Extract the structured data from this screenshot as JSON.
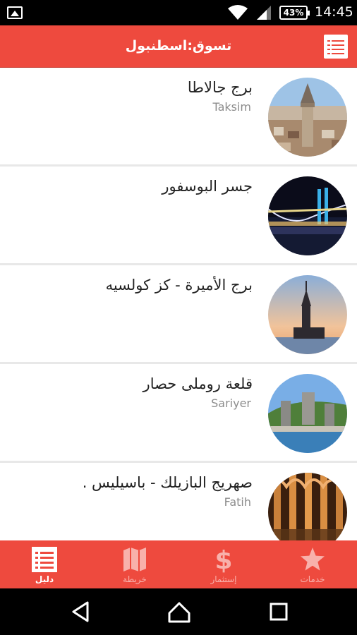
{
  "status_bar": {
    "battery": "43%",
    "time": "14:45"
  },
  "toolbar": {
    "title": "تسوق:اسطنبول"
  },
  "list": {
    "items": [
      {
        "title": "برج جالاطا",
        "subtitle": "Taksim"
      },
      {
        "title": "جسر البوسفور",
        "subtitle": ""
      },
      {
        "title": "برج الأميرة - كز كولسيه",
        "subtitle": ""
      },
      {
        "title": "قلعة روملى حصار",
        "subtitle": "Sariyer"
      },
      {
        "title": "صهريج البازيلك - باسيليس .",
        "subtitle": "Fatih"
      }
    ]
  },
  "tabs": [
    {
      "label": "خدمات",
      "icon": "star-icon"
    },
    {
      "label": "إستثمار",
      "icon": "dollar-icon"
    },
    {
      "label": "خريطة",
      "icon": "map-icon"
    },
    {
      "label": "دليل",
      "icon": "list-icon"
    }
  ],
  "colors": {
    "accent": "#ee4a3e",
    "tab_inactive": "#f8b1ab"
  }
}
